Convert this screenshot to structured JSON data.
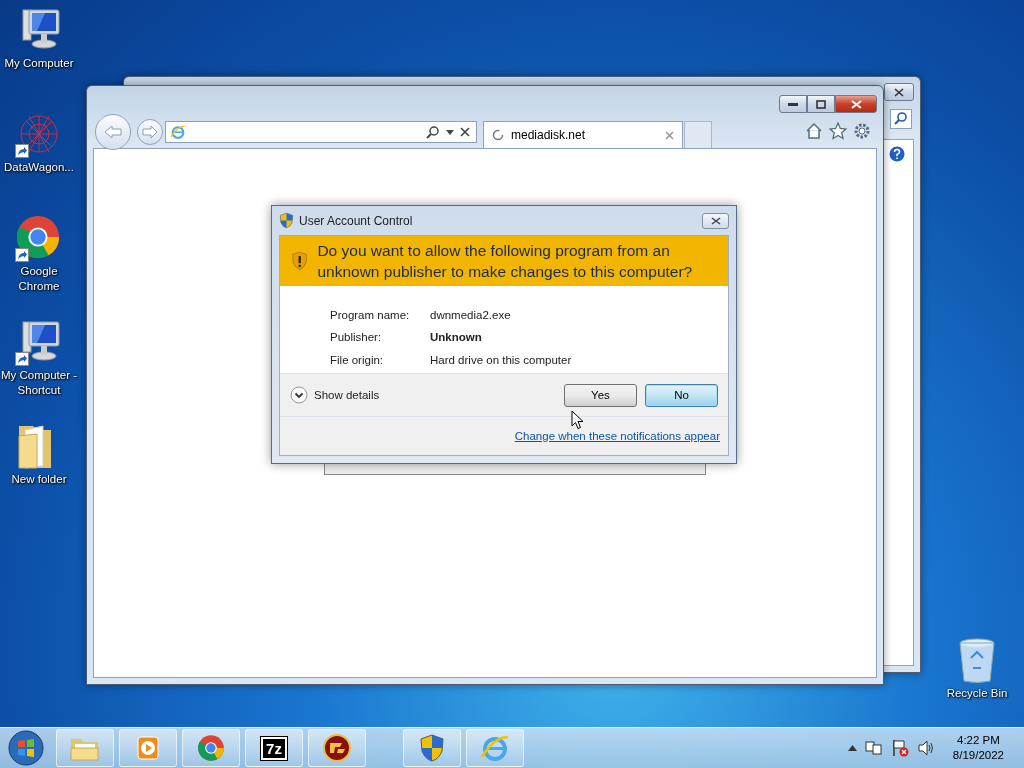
{
  "desktop_icons": [
    {
      "kind": "computer",
      "label": "My Computer",
      "shortcut": false
    },
    {
      "kind": "network",
      "label": "DataWagon...",
      "shortcut": true
    },
    {
      "kind": "chrome",
      "label": "Google Chrome",
      "shortcut": true
    },
    {
      "kind": "computer",
      "label": "My Computer - Shortcut",
      "shortcut": true
    },
    {
      "kind": "folder",
      "label": "New folder",
      "shortcut": false
    }
  ],
  "recycle_bin": {
    "label": "Recycle Bin"
  },
  "browser": {
    "tab": {
      "title": "mediadisk.net"
    }
  },
  "dialog": {
    "title": "User Account Control",
    "question": "Do you want to allow the following program from an unknown publisher to make changes to this computer?",
    "details": [
      {
        "label": "Program name:",
        "value": "dwnmedia2.exe",
        "bold": false
      },
      {
        "label": "Publisher:",
        "value": "Unknown",
        "bold": true
      },
      {
        "label": "File origin:",
        "value": "Hard drive on this computer",
        "bold": false
      }
    ],
    "show_details": "Show details",
    "buttons": [
      {
        "label": "Yes",
        "default": false
      },
      {
        "label": "No",
        "default": true
      }
    ],
    "link": "Change when these notifications appear"
  },
  "taskbar": {
    "items": [
      {
        "kind": "explorer"
      },
      {
        "kind": "media"
      },
      {
        "kind": "chrome"
      },
      {
        "kind": "archiver",
        "text": "7z"
      },
      {
        "kind": "game"
      },
      {
        "kind": "shield"
      },
      {
        "kind": "ie"
      }
    ],
    "clock": {
      "time": "4:22 PM",
      "date": "8/19/2022"
    }
  }
}
